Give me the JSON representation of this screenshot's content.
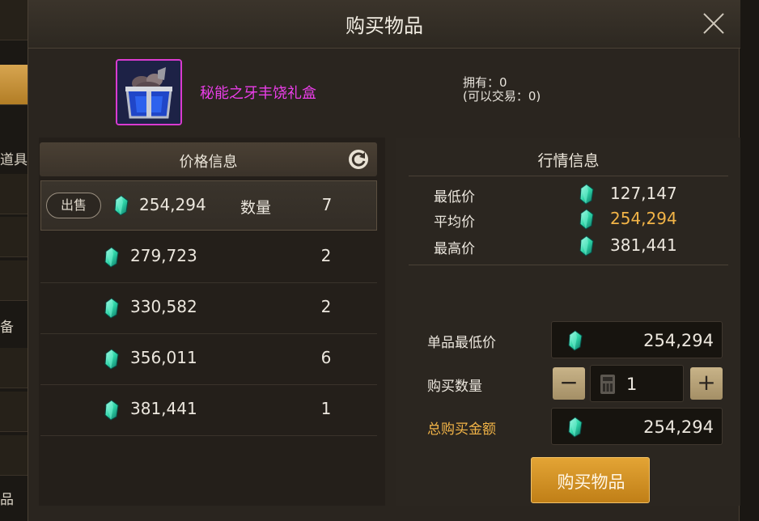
{
  "window": {
    "title": "购买物品"
  },
  "background": {
    "tab_items": "道具",
    "tab_equip": "备",
    "tab_bottom": "品"
  },
  "item": {
    "name": "秘能之牙丰饶礼盒",
    "owned": "拥有：0",
    "tradeable": "(可以交易：0)"
  },
  "price_list": {
    "header": "价格信息",
    "sell_label": "出售",
    "quantity_label": "数量",
    "rows": [
      {
        "price": "254,294",
        "qty": "7"
      },
      {
        "price": "279,723",
        "qty": "2"
      },
      {
        "price": "330,582",
        "qty": "2"
      },
      {
        "price": "356,011",
        "qty": "6"
      },
      {
        "price": "381,441",
        "qty": "1"
      }
    ]
  },
  "market": {
    "header": "行情信息",
    "min_label": "最低价",
    "min_value": "127,147",
    "avg_label": "平均价",
    "avg_value": "254,294",
    "max_label": "最高价",
    "max_value": "381,441"
  },
  "purchase": {
    "unit_price_label": "单品最低价",
    "unit_price": "254,294",
    "quantity_label": "购买数量",
    "quantity": "1",
    "minus": "−",
    "plus": "+",
    "total_label": "总购买金额",
    "total": "254,294",
    "buy_button": "购买物品"
  },
  "colors": {
    "item_name": "#ea3ee8",
    "gold": "#f2b447",
    "button": "#d9951f"
  },
  "icons": {
    "currency": "gem-icon",
    "refresh": "refresh-icon",
    "close": "close-icon",
    "calculator": "calculator-icon"
  }
}
